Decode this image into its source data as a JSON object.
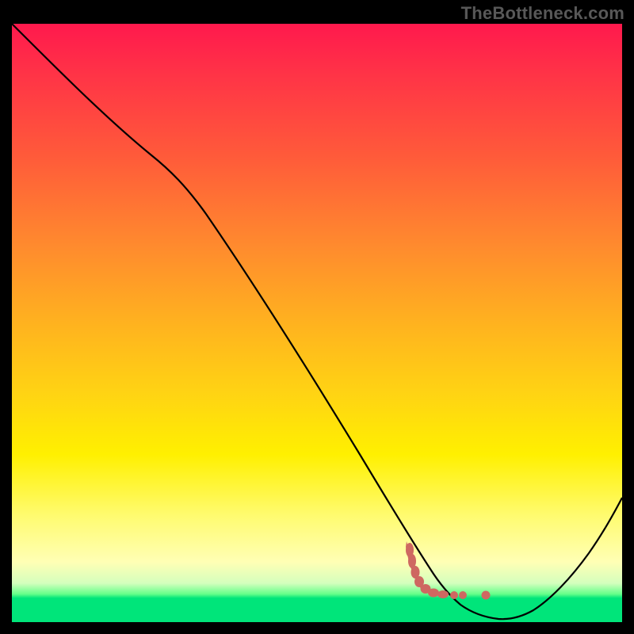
{
  "watermark": "TheBottleneck.com",
  "chart_data": {
    "type": "line",
    "title": "",
    "xlabel": "",
    "ylabel": "",
    "xlim": [
      0,
      100
    ],
    "ylim": [
      0,
      100
    ],
    "background_gradient": [
      "#ff194d",
      "#ff5a3a",
      "#ffb21f",
      "#fff000",
      "#ffffb5",
      "#00e57a"
    ],
    "series": [
      {
        "name": "bottleneck-curve",
        "x": [
          0,
          10,
          20,
          30,
          40,
          50,
          60,
          64,
          66,
          68,
          70,
          73,
          77,
          80,
          84,
          90,
          95,
          100
        ],
        "y": [
          100,
          92,
          82,
          70,
          56,
          42,
          28,
          19,
          14,
          10,
          6,
          3,
          1,
          0,
          1,
          9,
          18,
          29
        ]
      }
    ],
    "markers": {
      "name": "highlight-dots",
      "color": "#ce6861",
      "points": [
        {
          "x": 63.5,
          "y": 15
        },
        {
          "x": 64.0,
          "y": 11
        },
        {
          "x": 64.5,
          "y": 8
        },
        {
          "x": 65.0,
          "y": 6
        },
        {
          "x": 65.6,
          "y": 4.5
        },
        {
          "x": 66.4,
          "y": 3.5
        },
        {
          "x": 67.4,
          "y": 2.5
        },
        {
          "x": 68.6,
          "y": 2
        },
        {
          "x": 70.5,
          "y": 1.5
        },
        {
          "x": 72.4,
          "y": 1.5
        },
        {
          "x": 73.6,
          "y": 1.4
        },
        {
          "x": 77.2,
          "y": 1.2
        }
      ]
    }
  }
}
